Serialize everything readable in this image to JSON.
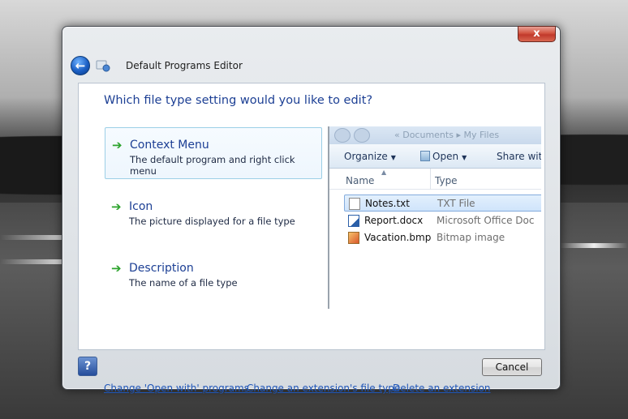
{
  "window": {
    "title": "Default Programs Editor",
    "close_label": "x"
  },
  "main": {
    "question": "Which file type setting would you like to edit?",
    "options": [
      {
        "title": "Context Menu",
        "description": "The default program and right click menu",
        "selected": true
      },
      {
        "title": "Icon",
        "description": "The picture displayed for a file type",
        "selected": false
      },
      {
        "title": "Description",
        "description": "The name of a file type",
        "selected": false
      }
    ]
  },
  "explorer": {
    "breadcrumb": "« Documents ▸ My Files",
    "toolbar": {
      "organize": "Organize",
      "open": "Open",
      "share": "Share with"
    },
    "columns": {
      "name": "Name",
      "type": "Type"
    },
    "files": [
      {
        "name": "Notes.txt",
        "type": "TXT File",
        "icon": "text-file-icon"
      },
      {
        "name": "Report.docx",
        "type": "Microsoft Office Doc",
        "icon": "word-document-icon"
      },
      {
        "name": "Vacation.bmp",
        "type": "Bitmap image",
        "icon": "bitmap-image-icon"
      }
    ]
  },
  "links": [
    "Change 'Open with' programs",
    "Change an extension's file type",
    "Delete an extension"
  ],
  "footer": {
    "help_label": "?",
    "cancel_label": "Cancel"
  },
  "colors": {
    "accent_link": "#1f56b8",
    "heading": "#1c3f94",
    "arrow": "#2ca32c",
    "close": "#c0392b"
  }
}
